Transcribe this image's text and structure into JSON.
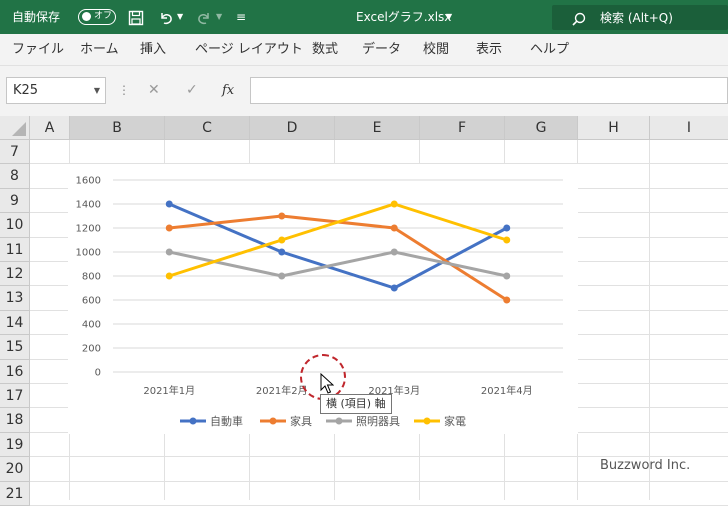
{
  "titlebar": {
    "autosave_label": "自動保存",
    "autosave_state": "オフ",
    "filename": "Excelグラフ.xlsx",
    "search_placeholder": "検索 (Alt+Q)",
    "accent": "#217346"
  },
  "ribbon": {
    "tabs": [
      "ファイル",
      "ホーム",
      "挿入",
      "ページ レイアウト",
      "数式",
      "データ",
      "校閲",
      "表示",
      "ヘルプ"
    ]
  },
  "formula_bar": {
    "name_box": "K25",
    "fx_label": "fx",
    "value": ""
  },
  "sheet": {
    "columns": [
      "A",
      "B",
      "C",
      "D",
      "E",
      "F",
      "G",
      "H",
      "I"
    ],
    "rows": [
      "7",
      "8",
      "9",
      "10",
      "11",
      "12",
      "13",
      "14",
      "15",
      "16",
      "17",
      "18",
      "19",
      "20",
      "21"
    ]
  },
  "chart_data": {
    "type": "line",
    "categories": [
      "2021年1月",
      "2021年2月",
      "2021年3月",
      "2021年4月"
    ],
    "series": [
      {
        "name": "自動車",
        "color": "#4472c4",
        "values": [
          1400,
          1000,
          700,
          1200
        ]
      },
      {
        "name": "家具",
        "color": "#ed7d31",
        "values": [
          1200,
          1300,
          1200,
          600
        ]
      },
      {
        "name": "照明器具",
        "color": "#a5a5a5",
        "values": [
          1000,
          800,
          1000,
          800
        ]
      },
      {
        "name": "家電",
        "color": "#ffc000",
        "values": [
          800,
          1100,
          1400,
          1100
        ]
      }
    ],
    "yticks": [
      "0",
      "200",
      "400",
      "600",
      "800",
      "1000",
      "1200",
      "1400",
      "1600"
    ],
    "ylim": [
      0,
      1600
    ],
    "grid": true,
    "legend": "bottom"
  },
  "tooltip": "横 (項目) 軸",
  "watermark": "Buzzword Inc."
}
